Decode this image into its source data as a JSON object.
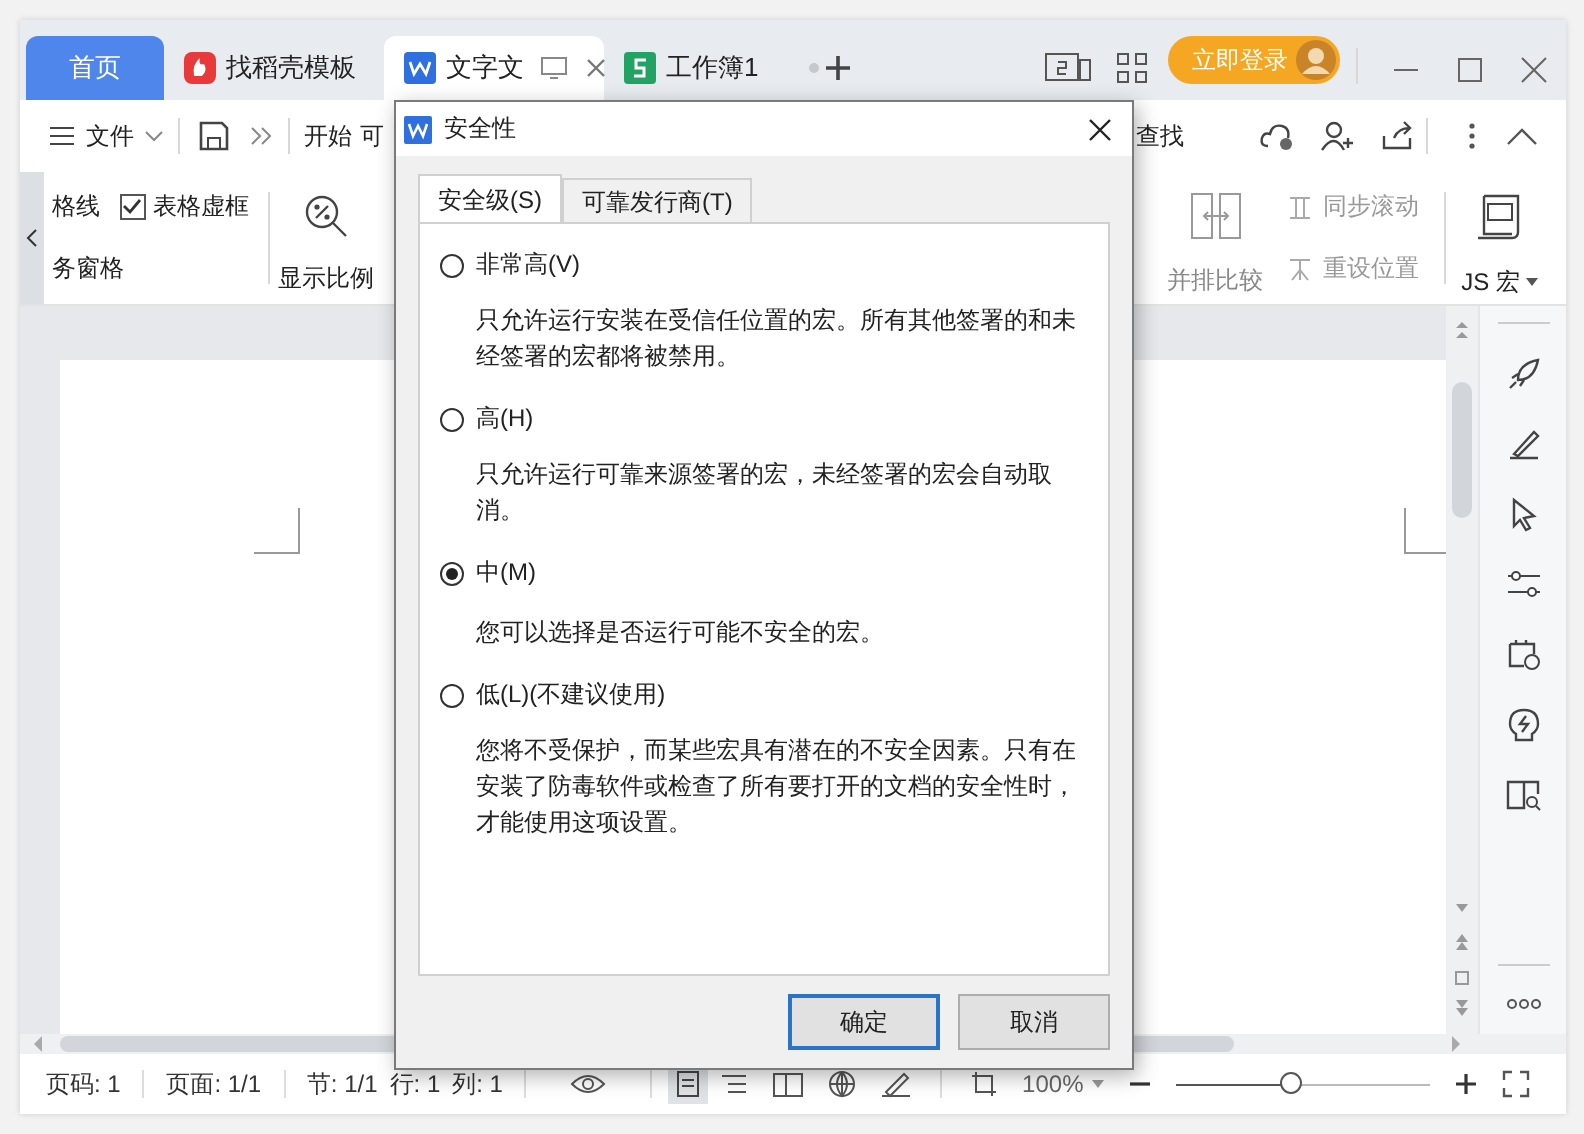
{
  "tabs": [
    {
      "kind": "home",
      "label": "首页",
      "selected": false
    },
    {
      "kind": "docer",
      "label": "找稻壳模板",
      "selected": false
    },
    {
      "kind": "writer",
      "label": "文字文",
      "selected": true
    },
    {
      "kind": "sheet",
      "label": "工作簿1",
      "selected": false
    }
  ],
  "login_button": "立即登录",
  "toolbar": {
    "file_menu": "文件",
    "start_tab": "开始",
    "next_tab": "可",
    "search": "查找"
  },
  "ribbon": {
    "left": [
      {
        "kind": "text",
        "label": "格线"
      },
      {
        "kind": "checkbox",
        "label": "表格虚框",
        "checked": true
      },
      {
        "kind": "text",
        "label": "务窗格"
      }
    ],
    "zoom_label": "显示比例",
    "compare_label": "并排比较",
    "sync": [
      {
        "label": "同步滚动",
        "disabled": true
      },
      {
        "label": "重设位置",
        "disabled": true
      }
    ],
    "macro_label": "JS 宏"
  },
  "status_bar": {
    "items": [
      "页码: 1",
      "页面: 1/1",
      "节: 1/1",
      "行: 1",
      "列: 1"
    ],
    "zoom": "100%",
    "zoom_slider": {
      "level": 0.46
    }
  },
  "dialog": {
    "title": "安全性",
    "tabs": [
      {
        "label": "安全级(S)",
        "selected": true
      },
      {
        "label": "可靠发行商(T)",
        "selected": false
      }
    ],
    "options": [
      {
        "label": "非常高(V)",
        "description": "只允许运行安装在受信任位置的宏。所有其他签署的和未经签署的宏都将被禁用。",
        "selected": false
      },
      {
        "label": "高(H)",
        "description": "只允许运行可靠来源签署的宏，未经签署的宏会自动取消。",
        "selected": false
      },
      {
        "label": "中(M)",
        "description": "您可以选择是否运行可能不安全的宏。",
        "selected": true
      },
      {
        "label": "低(L)(不建议使用)",
        "description": "您将不受保护，而某些宏具有潜在的不安全因素。只有在安装了防毒软件或检查了所有要打开的文档的安全性时，才能使用这项设置。",
        "selected": false
      }
    ],
    "buttons": [
      {
        "kind": "primary",
        "label": "确定"
      },
      {
        "kind": "normal",
        "label": "取消"
      }
    ]
  }
}
